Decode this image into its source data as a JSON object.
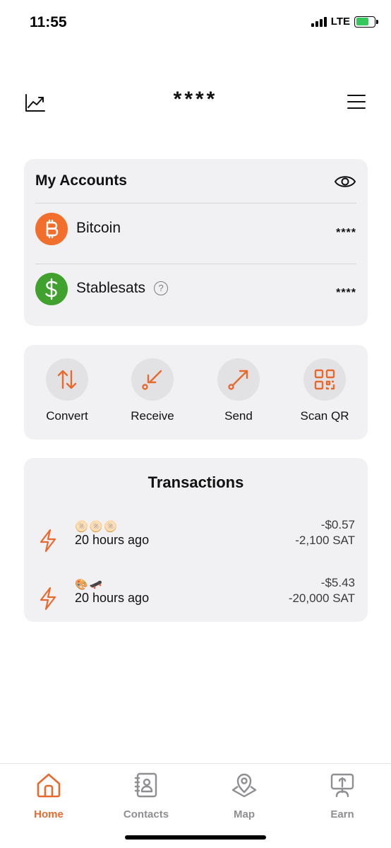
{
  "status": {
    "time": "11:55",
    "network": "LTE"
  },
  "header": {
    "balance": "****"
  },
  "accounts": {
    "title": "My Accounts",
    "items": [
      {
        "name": "Bitcoin",
        "value": "****",
        "icon": "bitcoin-icon",
        "color": "#f26e2d"
      },
      {
        "name": "Stablesats",
        "value": "****",
        "icon": "dollar-icon",
        "color": "#41a12f"
      }
    ]
  },
  "actions": [
    {
      "label": "Convert",
      "icon": "convert-icon"
    },
    {
      "label": "Receive",
      "icon": "receive-icon"
    },
    {
      "label": "Send",
      "icon": "send-icon"
    },
    {
      "label": "Scan QR",
      "icon": "qr-icon"
    }
  ],
  "transactions": {
    "title": "Transactions",
    "items": [
      {
        "memo": "🫓🫓🫓",
        "time": "20 hours ago",
        "usd": "-$0.57",
        "sat": "-2,100 SAT"
      },
      {
        "memo": "🎨🛹",
        "time": "20 hours ago",
        "usd": "-$5.43",
        "sat": "-20,000 SAT"
      }
    ]
  },
  "tabs": [
    {
      "label": "Home",
      "icon": "home-icon",
      "active": true
    },
    {
      "label": "Contacts",
      "icon": "contacts-icon",
      "active": false
    },
    {
      "label": "Map",
      "icon": "map-icon",
      "active": false
    },
    {
      "label": "Earn",
      "icon": "earn-icon",
      "active": false
    }
  ],
  "colors": {
    "accent": "#e8692e",
    "card": "#f1f1f3",
    "inactive": "#8e8e93"
  }
}
